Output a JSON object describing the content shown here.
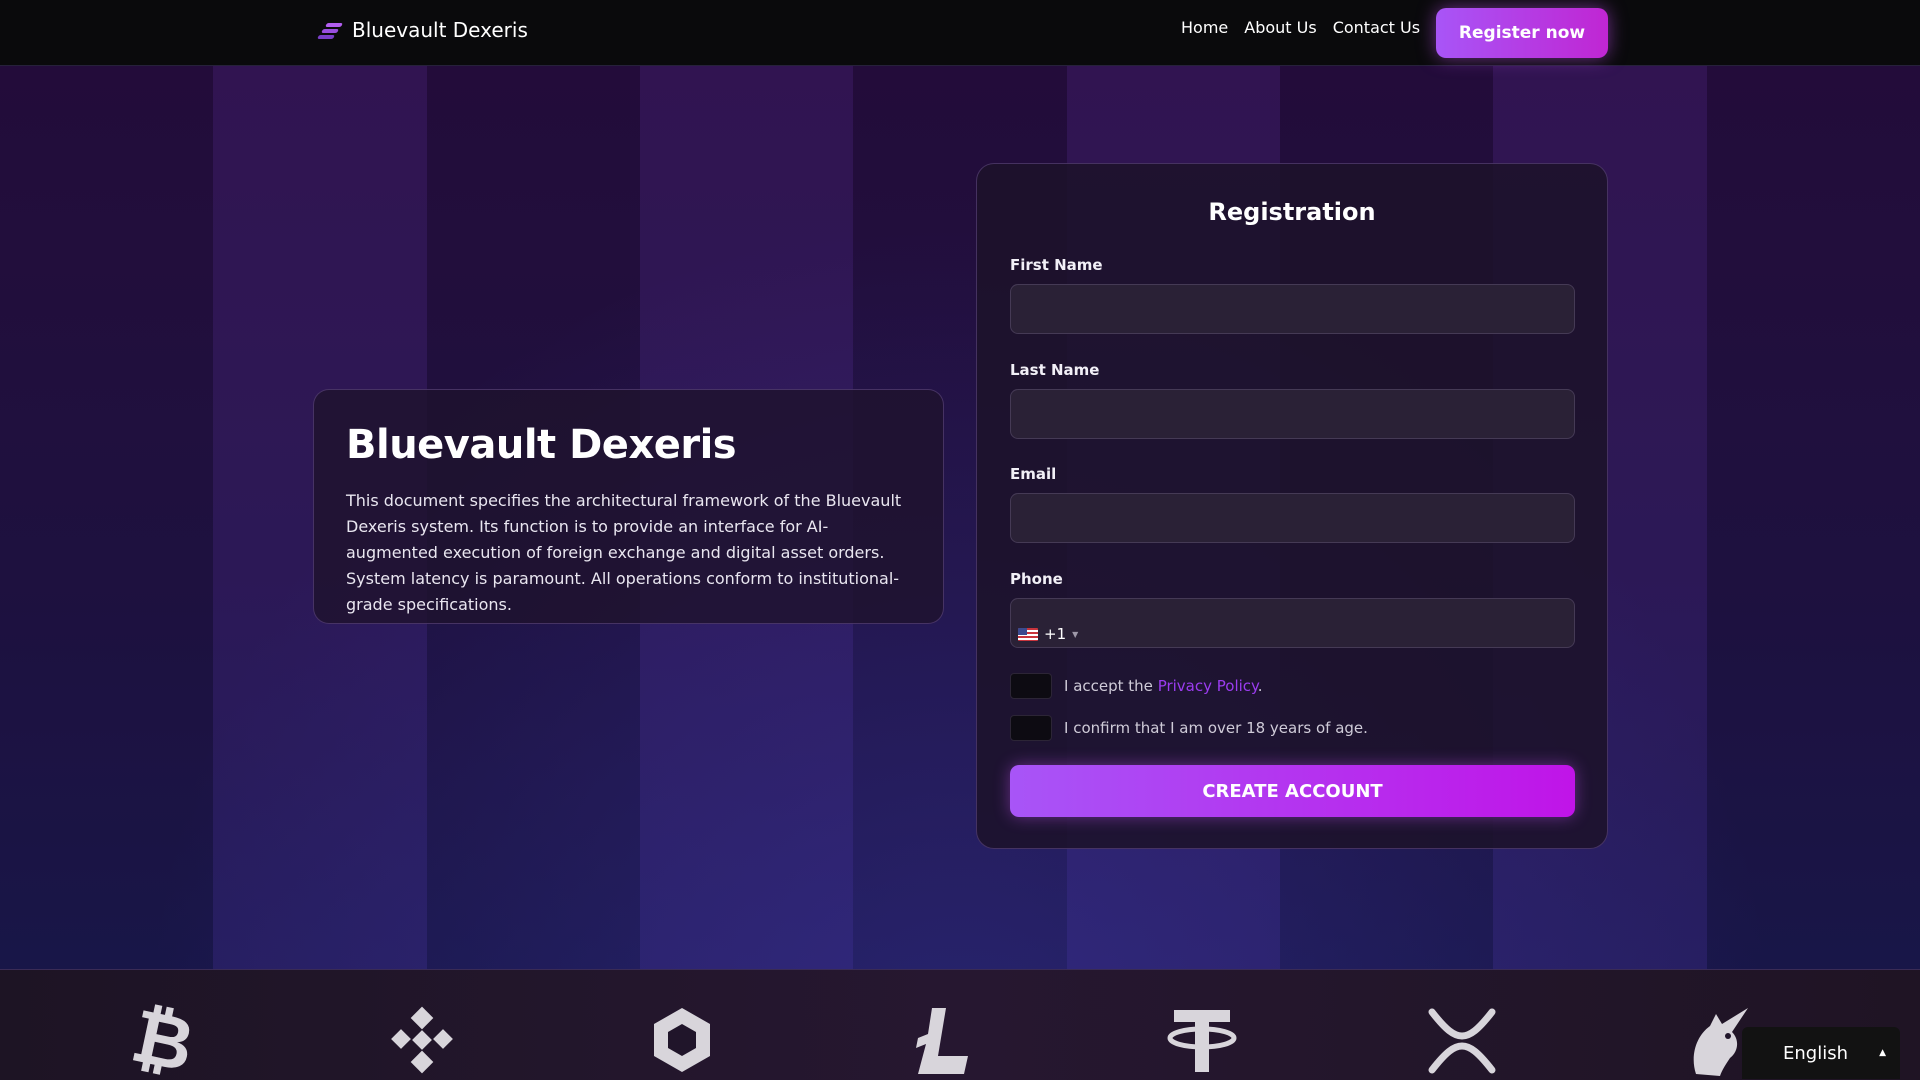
{
  "header": {
    "brand": "Bluevault Dexeris",
    "nav": [
      {
        "label": "Home"
      },
      {
        "label": "About Us"
      },
      {
        "label": "Contact Us"
      }
    ],
    "register_label": "Register now",
    "accent_color": "#a855f7"
  },
  "info": {
    "title": "Bluevault Dexeris",
    "description": "This document specifies the architectural framework of the Bluevault Dexeris system. Its function is to provide an interface for AI-augmented execution of foreign exchange and digital asset orders. System latency is paramount. All operations conform to institutional-grade specifications."
  },
  "registration": {
    "title": "Registration",
    "first_name_label": "First Name",
    "first_name_value": "",
    "last_name_label": "Last Name",
    "last_name_value": "",
    "email_label": "Email",
    "email_value": "",
    "phone_label": "Phone",
    "phone_country_icon": "us-flag-icon",
    "phone_dial_code": "+1",
    "phone_value": "",
    "privacy_prefix": "I accept the",
    "privacy_link": "Privacy Policy",
    "privacy_suffix": ".",
    "age_confirm": "I confirm that I am over 18 years of age.",
    "submit_label": "CREATE ACCOUNT"
  },
  "crypto_strip": {
    "icons": [
      "bitcoin-icon",
      "binance-icon",
      "chainlink-icon",
      "litecoin-icon",
      "tether-icon",
      "xrp-icon",
      "unicorn-icon"
    ]
  },
  "language": {
    "selected": "English"
  }
}
